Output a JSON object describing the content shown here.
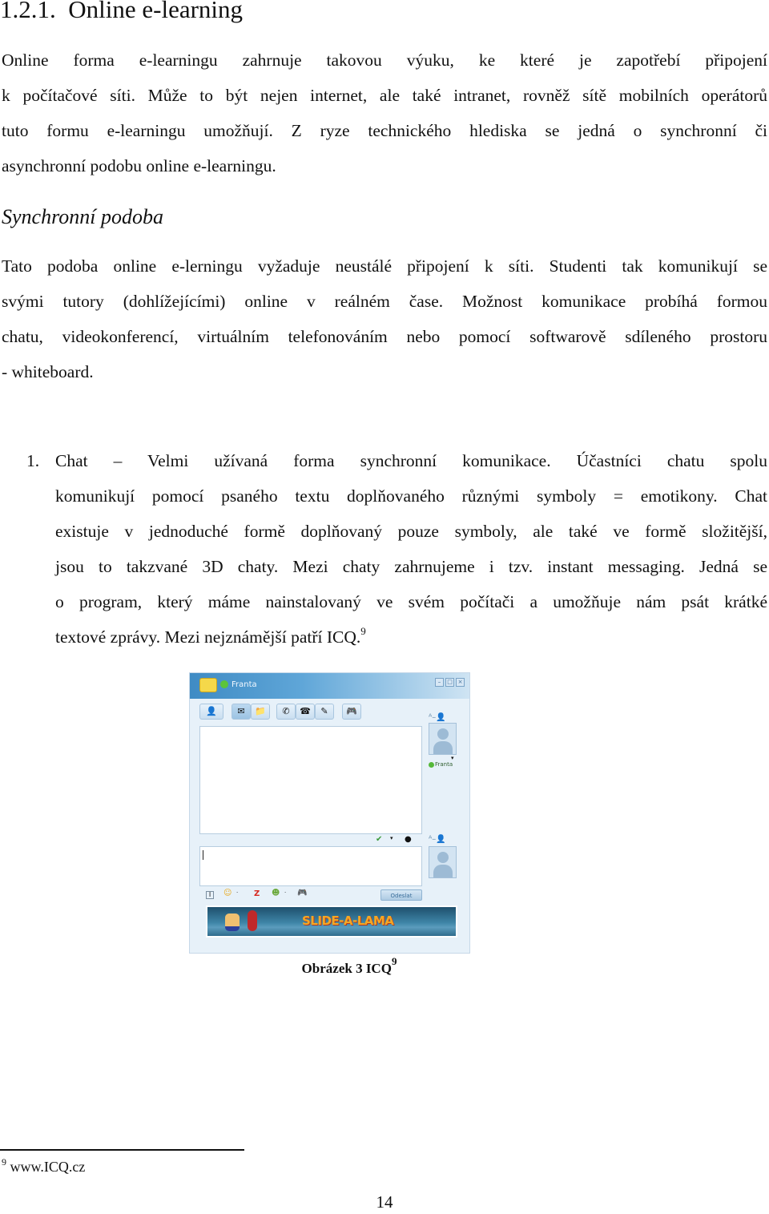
{
  "section": {
    "number": "1.2.1.",
    "title": "Online e-learning"
  },
  "intro_lines": [
    "Online forma e-learningu zahrnuje takovou výuku, ke které je zapotřebí připojení",
    "k počítačové síti. Může to být nejen internet, ale také intranet, rovněž sítě mobilních operátorů",
    "tuto formu e-learningu umožňují. Z ryze technického hlediska se jedná o synchronní či",
    "asynchronní podobu online e-learningu."
  ],
  "subsection": {
    "title": "Synchronní podoba",
    "lines": [
      "Tato podoba online e-lerningu vyžaduje neustálé připojení k síti. Studenti tak komunikují se",
      "svými tutory (dohlížejícími) online v reálném čase. Možnost komunikace probíhá formou",
      "chatu, videokonferencí, virtuálním telefonováním nebo pomocí softwarově sdíleného prostoru",
      "- whiteboard."
    ]
  },
  "list": {
    "items": [
      {
        "number": "1.",
        "lines": [
          "Chat – Velmi užívaná forma synchronní komunikace. Účastníci chatu spolu",
          "komunikují pomocí psaného textu doplňovaného různými symboly = emotikony. Chat",
          "existuje v jednoduché formě doplňovaný pouze symboly, ale také ve formě složitější,",
          "jsou to takzvané 3D chaty. Mezi chaty zahrnujeme i tzv. instant messaging. Jedná se",
          "o program, který máme nainstalovaný ve svém počítači a umožňuje nám psát krátké",
          "textové zprávy. Mezi nejznámější patří ICQ."
        ],
        "footnote_ref": "9"
      }
    ]
  },
  "figure": {
    "icq_window": {
      "contact_name": "Franta",
      "window_buttons": [
        "minimize",
        "maximize",
        "close"
      ],
      "toolbar_icons": [
        "contact-card-icon",
        "chat-icon",
        "file-transfer-icon",
        "call-icon",
        "voice-icon",
        "sms-icon",
        "games-icon"
      ],
      "avatar_label": "Franta",
      "input_value": "",
      "format_icons": [
        "font-icon",
        "smiley-icon",
        "nudge-icon",
        "emoticon-icon",
        "gamepad-icon"
      ],
      "send_label": "Odeslat",
      "banner_text": "SLIDE-A-LAMA"
    },
    "caption": "Obrázek 3 ICQ",
    "caption_ref": "9"
  },
  "footnote": {
    "number": "9",
    "text": "www.ICQ.cz"
  },
  "page_number": "14"
}
